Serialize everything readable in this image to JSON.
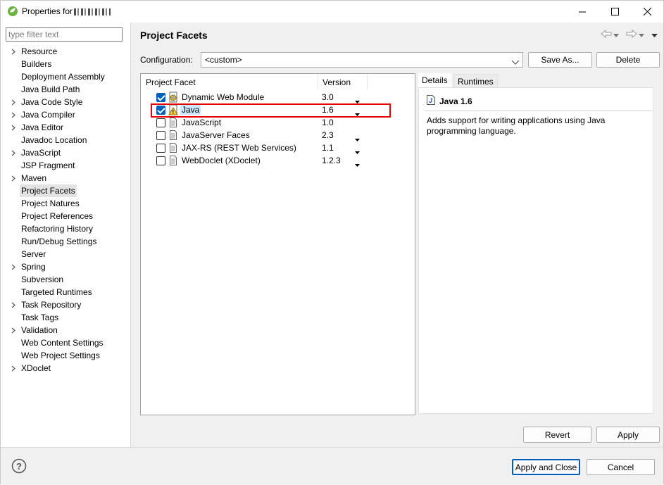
{
  "window": {
    "title": "Properties for",
    "minimize_label": "—",
    "maximize_label": "☐",
    "close_label": "✕"
  },
  "left": {
    "filter_placeholder": "type filter text",
    "items": [
      {
        "label": "Resource",
        "expandable": true
      },
      {
        "label": "Builders",
        "expandable": false
      },
      {
        "label": "Deployment Assembly",
        "expandable": false
      },
      {
        "label": "Java Build Path",
        "expandable": false
      },
      {
        "label": "Java Code Style",
        "expandable": true
      },
      {
        "label": "Java Compiler",
        "expandable": true
      },
      {
        "label": "Java Editor",
        "expandable": true
      },
      {
        "label": "Javadoc Location",
        "expandable": false
      },
      {
        "label": "JavaScript",
        "expandable": true
      },
      {
        "label": "JSP Fragment",
        "expandable": false
      },
      {
        "label": "Maven",
        "expandable": true
      },
      {
        "label": "Project Facets",
        "expandable": false,
        "selected": true
      },
      {
        "label": "Project Natures",
        "expandable": false
      },
      {
        "label": "Project References",
        "expandable": false
      },
      {
        "label": "Refactoring History",
        "expandable": false
      },
      {
        "label": "Run/Debug Settings",
        "expandable": false
      },
      {
        "label": "Server",
        "expandable": false
      },
      {
        "label": "Spring",
        "expandable": true
      },
      {
        "label": "Subversion",
        "expandable": false
      },
      {
        "label": "Targeted Runtimes",
        "expandable": false
      },
      {
        "label": "Task Repository",
        "expandable": true
      },
      {
        "label": "Task Tags",
        "expandable": false
      },
      {
        "label": "Validation",
        "expandable": true
      },
      {
        "label": "Web Content Settings",
        "expandable": false
      },
      {
        "label": "Web Project Settings",
        "expandable": false
      },
      {
        "label": "XDoclet",
        "expandable": true
      }
    ]
  },
  "main": {
    "title": "Project Facets",
    "configuration_label": "Configuration:",
    "configuration_value": "<custom>",
    "save_as_label": "Save As...",
    "delete_label": "Delete",
    "table": {
      "col_facet": "Project Facet",
      "col_version": "Version",
      "rows": [
        {
          "name": "Dynamic Web Module",
          "version": "3.0",
          "checked": true,
          "dropdown": true,
          "icon": "web-module-icon"
        },
        {
          "name": "Java",
          "version": "1.6",
          "checked": true,
          "dropdown": true,
          "icon": "java-facet-icon",
          "selected": true
        },
        {
          "name": "JavaScript",
          "version": "1.0",
          "checked": false,
          "dropdown": false,
          "icon": "document-icon"
        },
        {
          "name": "JavaServer Faces",
          "version": "2.3",
          "checked": false,
          "dropdown": true,
          "icon": "document-icon"
        },
        {
          "name": "JAX-RS (REST Web Services)",
          "version": "1.1",
          "checked": false,
          "dropdown": true,
          "icon": "document-icon"
        },
        {
          "name": "WebDoclet (XDoclet)",
          "version": "1.2.3",
          "checked": false,
          "dropdown": true,
          "icon": "document-icon"
        }
      ]
    },
    "details": {
      "tab_details": "Details",
      "tab_runtimes": "Runtimes",
      "title": "Java 1.6",
      "description": "Adds support for writing applications using Java programming language."
    },
    "revert_label": "Revert",
    "apply_label": "Apply"
  },
  "footer": {
    "apply_close_label": "Apply and Close",
    "cancel_label": "Cancel"
  },
  "colors": {
    "accent": "#005fb8",
    "highlight_box": "#e00000",
    "selection": "#cce8ff"
  }
}
